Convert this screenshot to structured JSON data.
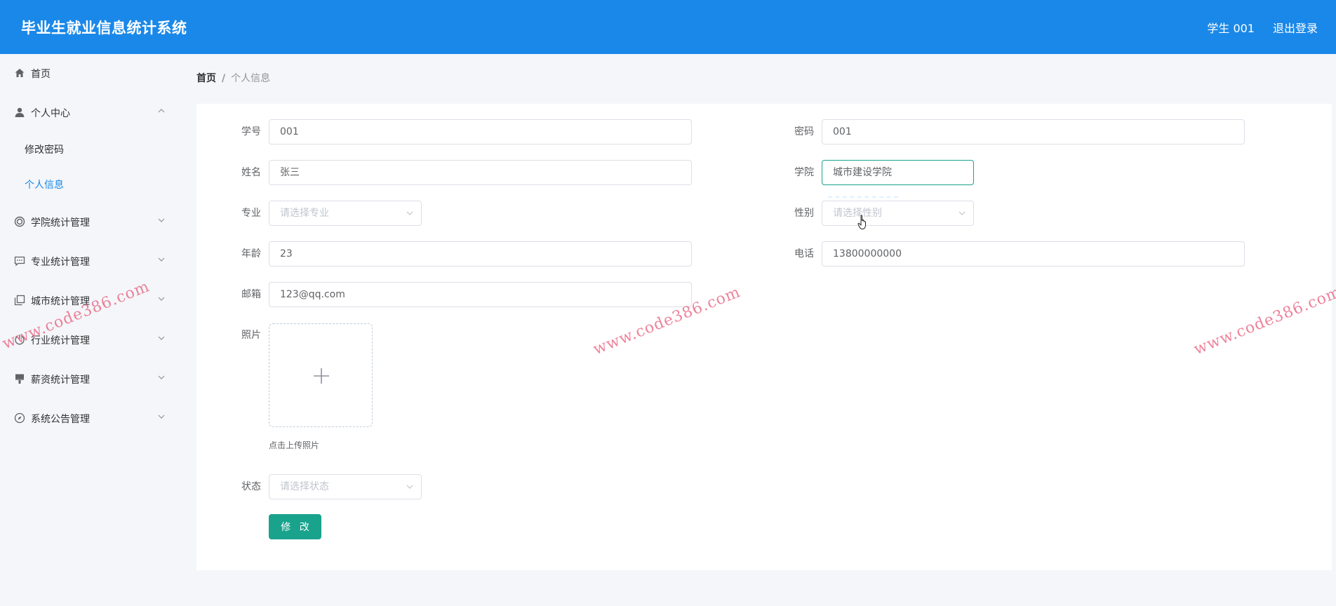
{
  "header": {
    "title": "毕业生就业信息统计系统",
    "user": "学生 001",
    "logout": "退出登录",
    "bg_color": "#1a88e8"
  },
  "sidebar": {
    "items": [
      {
        "label": "首页",
        "icon": "home-icon"
      },
      {
        "label": "个人中心",
        "icon": "user-icon",
        "expanded": true
      },
      {
        "label": "修改密码"
      },
      {
        "label": "个人信息",
        "active": true
      },
      {
        "label": "学院统计管理",
        "icon": "circle-icon"
      },
      {
        "label": "专业统计管理",
        "icon": "message-icon"
      },
      {
        "label": "城市统计管理",
        "icon": "copy-icon"
      },
      {
        "label": "行业统计管理",
        "icon": "power-icon"
      },
      {
        "label": "薪资统计管理",
        "icon": "brush-icon"
      },
      {
        "label": "系统公告管理",
        "icon": "compass-icon"
      }
    ]
  },
  "breadcrumb": {
    "home": "首页",
    "separator": "/",
    "current": "个人信息"
  },
  "form": {
    "student_id": {
      "label": "学号",
      "value": "001"
    },
    "password": {
      "label": "密码",
      "value": "001"
    },
    "name": {
      "label": "姓名",
      "value": "张三"
    },
    "college": {
      "label": "学院",
      "value": "城市建设学院"
    },
    "major": {
      "label": "专业",
      "placeholder": "请选择专业"
    },
    "gender": {
      "label": "性别",
      "placeholder": "请选择性别"
    },
    "age": {
      "label": "年龄",
      "value": "23"
    },
    "phone": {
      "label": "电话",
      "value": "13800000000"
    },
    "email": {
      "label": "邮箱",
      "value": "123@qq.com"
    },
    "photo": {
      "label": "照片",
      "hint": "点击上传照片"
    },
    "status": {
      "label": "状态",
      "placeholder": "请选择状态"
    },
    "submit_label": "修 改"
  },
  "accent_color": "#19a38c",
  "watermark": "www.code386.com"
}
